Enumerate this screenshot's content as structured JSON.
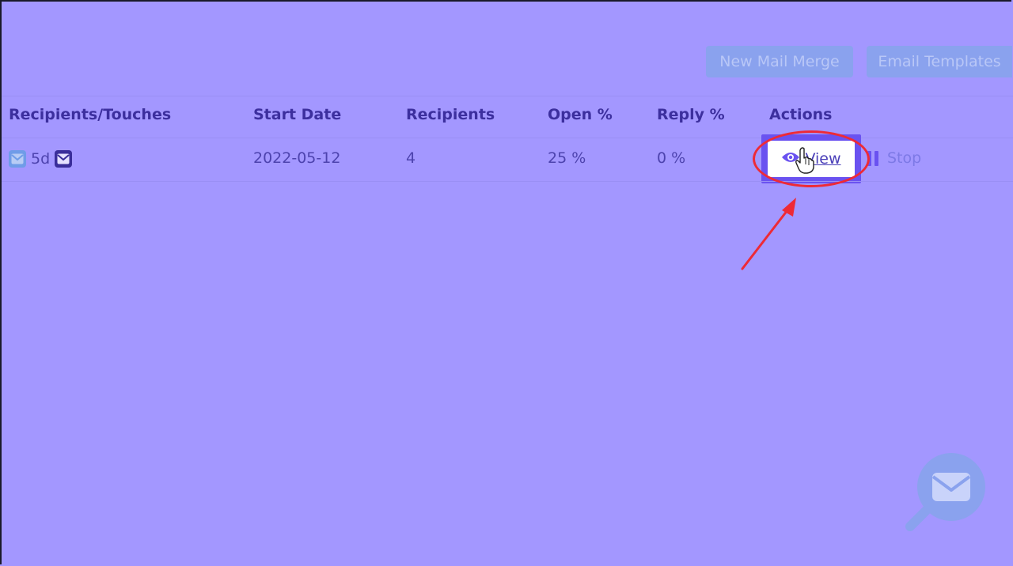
{
  "toolbar": {
    "new_mail_merge": "New Mail Merge",
    "email_templates": "Email Templates"
  },
  "table": {
    "headers": [
      "Recipients/Touches",
      "Start Date",
      "Recipients",
      "Open %",
      "Reply %",
      "Actions"
    ],
    "rows": [
      {
        "touch_delay": "5d",
        "start_date": "2022-05-12",
        "recipients": "4",
        "open_pct": "25 %",
        "reply_pct": "0 %",
        "actions": {
          "view": "View",
          "stop": "Stop"
        }
      }
    ]
  },
  "icons": {
    "touch_first": "mail-icon",
    "touch_second": "mail-icon",
    "view": "eye-icon",
    "stop": "pause-icon",
    "chat": "mail-search-icon"
  },
  "colors": {
    "overlay_background": "#a397ff",
    "highlight": "#6a52f0",
    "annotation": "#ee2a36",
    "header_text": "#3c2f9e"
  }
}
